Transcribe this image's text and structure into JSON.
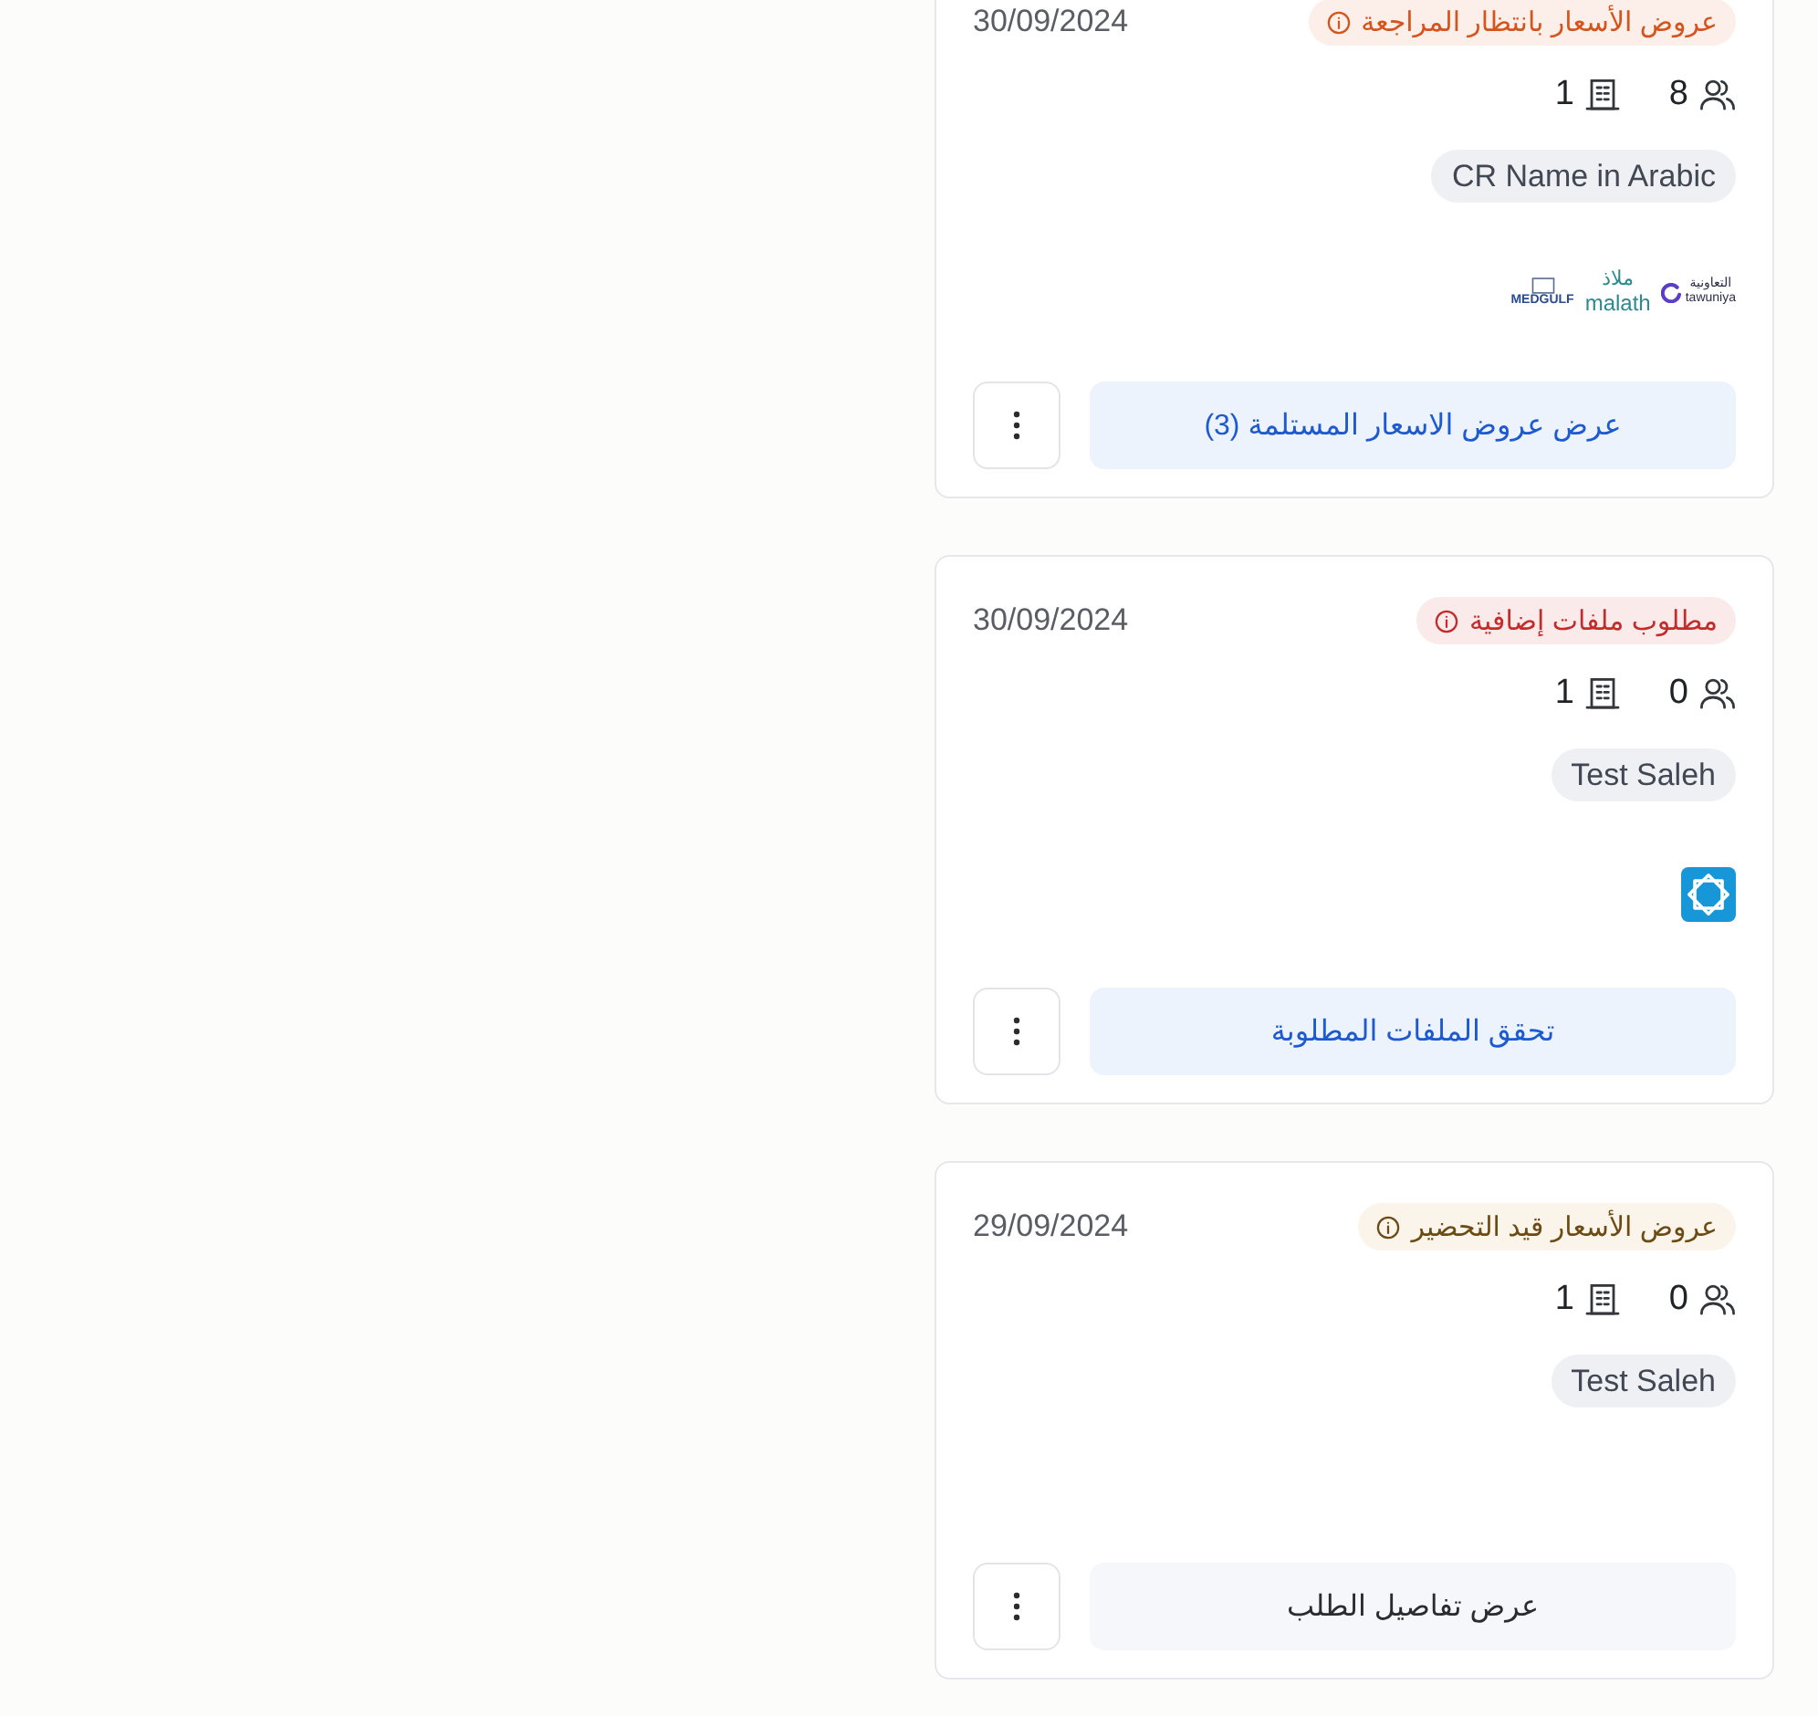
{
  "cards": [
    {
      "status": {
        "label": "عروض الأسعار بانتظار المراجعة",
        "color": "#d4541c"
      },
      "date": "30/09/2024",
      "counts": [
        {
          "kind": "people",
          "value": "8"
        },
        {
          "kind": "building",
          "value": "1"
        }
      ],
      "tag": "CR Name in Arabic",
      "logos": [
        {
          "kind": "ring-mark",
          "texts": [
            "التعاونية",
            "tawuniya"
          ]
        },
        {
          "kind": "stacked-mark",
          "texts": [
            "ملاذ",
            "malath"
          ]
        },
        {
          "kind": "frame-mark",
          "texts": [
            "MEDGULF"
          ]
        }
      ],
      "action": {
        "label": "عرض عروض الاسعار المستلمة (3)",
        "kind": "primary"
      }
    },
    {
      "status": {
        "label": "مطلوب ملفات إضافية",
        "color": "#c42b2b"
      },
      "date": "30/09/2024",
      "counts": [
        {
          "kind": "people",
          "value": "0"
        },
        {
          "kind": "building",
          "value": "1"
        }
      ],
      "tag": "Test Saleh",
      "logos": [
        {
          "kind": "knot-tile"
        }
      ],
      "action": {
        "label": "تحقق الملفات المطلوبة",
        "kind": "primary"
      }
    },
    {
      "status": {
        "label": "عروض الأسعار قيد التحضير",
        "color": "#6b4a14"
      },
      "date": "29/09/2024",
      "counts": [
        {
          "kind": "people",
          "value": "0"
        },
        {
          "kind": "building",
          "value": "1"
        }
      ],
      "tag": "Test Saleh",
      "action": {
        "label": "عرض تفاصيل الطلب",
        "kind": "secondary"
      }
    }
  ]
}
